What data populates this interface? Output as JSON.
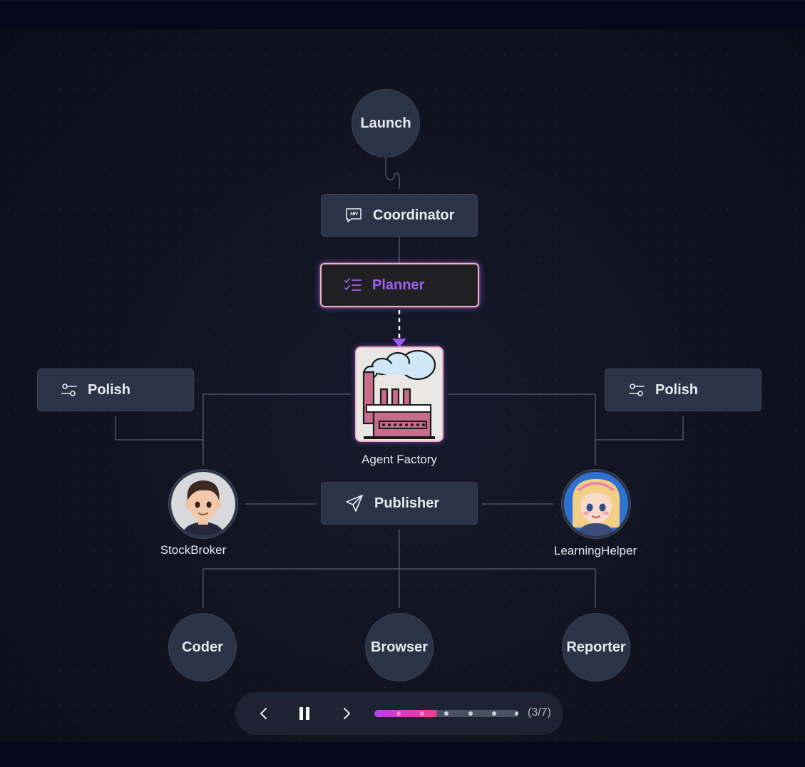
{
  "nodes": {
    "launch": "Launch",
    "coordinator": "Coordinator",
    "planner": "Planner",
    "agent_factory": "Agent Factory",
    "polish_left": "Polish",
    "polish_right": "Polish",
    "publisher": "Publisher",
    "stockbroker": "StockBroker",
    "learninghelper": "LearningHelper",
    "coder": "Coder",
    "browser": "Browser",
    "reporter": "Reporter"
  },
  "player": {
    "counter": "(3/7)",
    "current_step": 3,
    "total_steps": 7,
    "progress_fraction": 0.43
  },
  "colors": {
    "accent_purple": "#a061f0",
    "highlight_pink": "#f2b0cc",
    "node_bg": "#2b3446",
    "edge": "#4a5468"
  },
  "icons": {
    "coordinator": "chat-quote-icon",
    "planner": "checklist-icon",
    "polish": "sliders-icon",
    "publisher": "send-icon",
    "prev": "chevron-left-icon",
    "pause": "pause-icon",
    "next": "chevron-right-icon"
  }
}
